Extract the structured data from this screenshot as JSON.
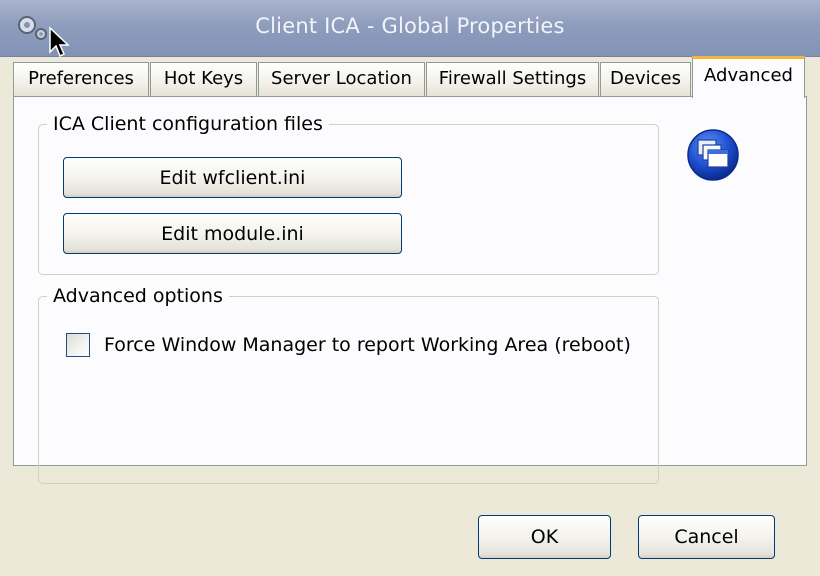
{
  "window": {
    "title": "Client ICA - Global Properties"
  },
  "icons": {
    "app": "gears-icon",
    "corner": "windows-stack-icon",
    "cursor": "mouse-cursor-icon"
  },
  "tabs": [
    {
      "label": "Preferences",
      "active": false
    },
    {
      "label": "Hot Keys",
      "active": false
    },
    {
      "label": "Server Location",
      "active": false
    },
    {
      "label": "Firewall Settings",
      "active": false
    },
    {
      "label": "Devices",
      "active": false
    },
    {
      "label": "Advanced",
      "active": true
    }
  ],
  "config_group": {
    "title": "ICA Client configuration files",
    "edit_wfclient_label": "Edit wfclient.ini",
    "edit_module_label": "Edit module.ini"
  },
  "advanced_group": {
    "title": "Advanced options",
    "force_wm_label": "Force Window Manager to report Working Area (reboot)",
    "force_wm_checked": false
  },
  "footer": {
    "ok_label": "OK",
    "cancel_label": "Cancel"
  },
  "colors": {
    "titlebar": "#8e9dbd",
    "active_tab_accent": "#f5b43c",
    "button_border": "#003c74"
  }
}
